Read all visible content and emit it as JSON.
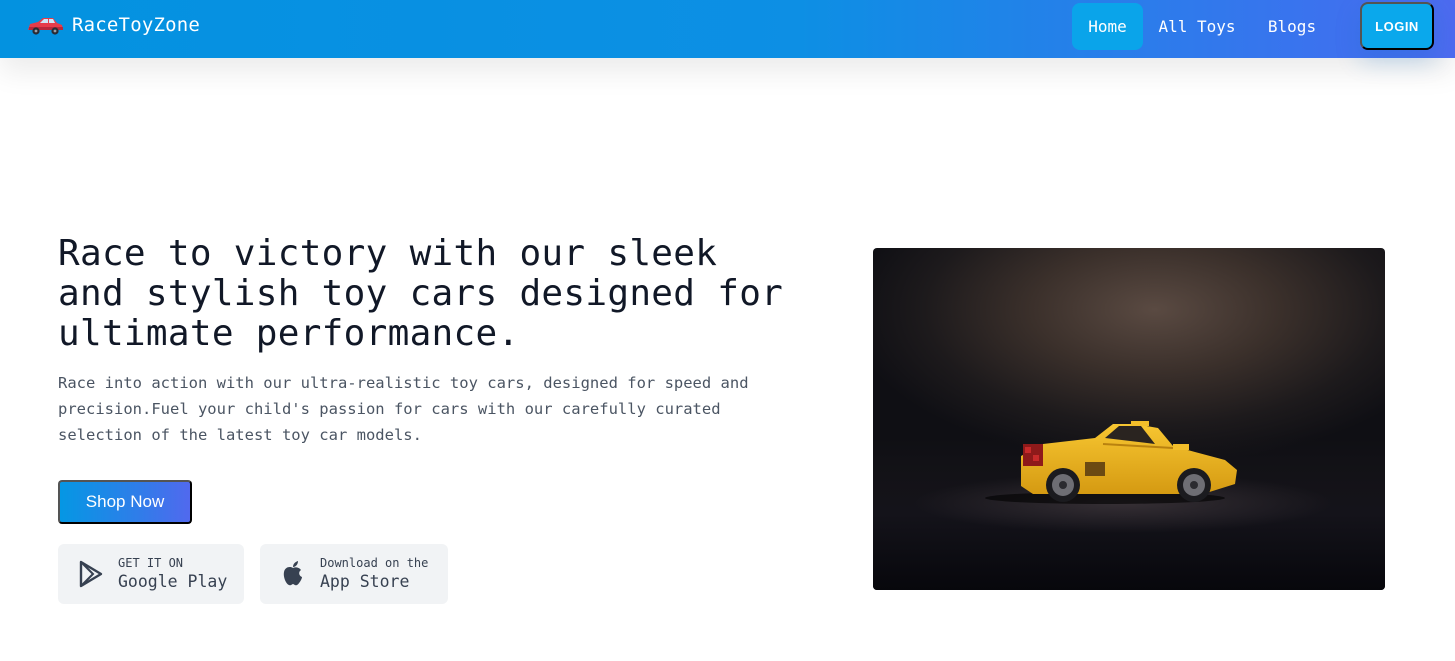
{
  "brand": {
    "name": "RaceToyZone",
    "logo_icon": "red-race-car-icon"
  },
  "nav": {
    "items": [
      {
        "label": "Home",
        "active": true
      },
      {
        "label": "All Toys",
        "active": false
      },
      {
        "label": "Blogs",
        "active": false
      }
    ],
    "login_label": "LOGIN"
  },
  "hero": {
    "title": "Race to victory with our sleek and stylish toy cars designed for ultimate performance.",
    "subtitle": "Race into action with our ultra-realistic toy cars, designed for speed and precision.Fuel your child's passion for cars with our carefully curated selection of the latest toy car models.",
    "cta_label": "Shop Now",
    "stores": [
      {
        "small": "GET IT ON",
        "big": "Google Play",
        "icon": "google-play-icon"
      },
      {
        "small": "Download on the",
        "big": "App Store",
        "icon": "apple-icon"
      }
    ],
    "image_icon": "yellow-toy-car-photo"
  },
  "colors": {
    "nav_gradient_start": "#0392e0",
    "nav_gradient_end": "#4d6bef",
    "active_nav": "#0aa4ea",
    "button_gradient_start": "#0597e4",
    "button_gradient_end": "#5169ee",
    "store_bg": "#f1f3f5"
  }
}
